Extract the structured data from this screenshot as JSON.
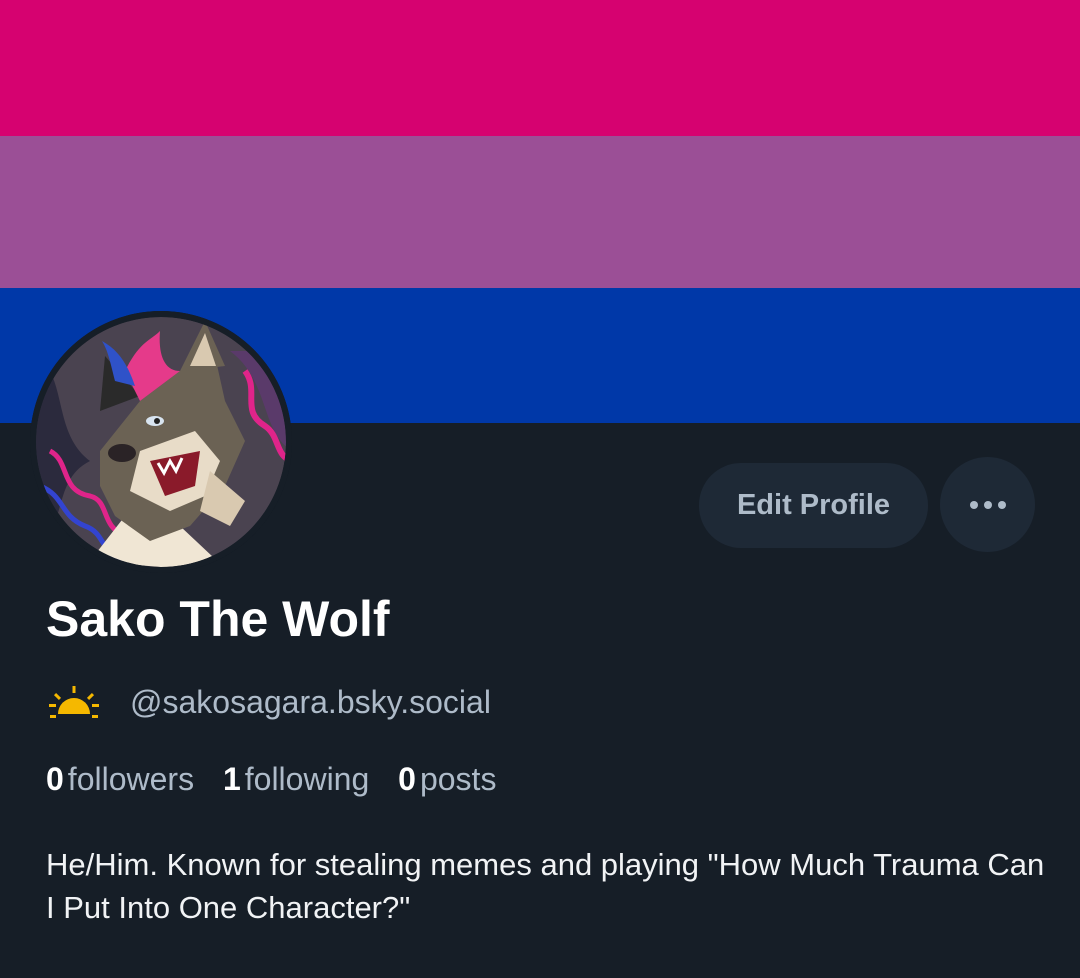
{
  "banner": {
    "colors": [
      "#d60270",
      "#9b4f96",
      "#0038a8"
    ]
  },
  "profile": {
    "avatar_icon": "wolf-avatar-image",
    "display_name": "Sako The Wolf",
    "handle": "@sakosagara.bsky.social",
    "handle_icon": "sunrise-icon",
    "bio": "He/Him. Known for stealing memes and playing \"How Much Trauma Can I Put Into One Character?\""
  },
  "actions": {
    "edit_profile_label": "Edit Profile",
    "more_icon": "more-horizontal-icon"
  },
  "stats": {
    "followers_count": "0",
    "followers_label": "followers",
    "following_count": "1",
    "following_label": "following",
    "posts_count": "0",
    "posts_label": "posts"
  },
  "colors": {
    "background": "#161e27",
    "button_background": "#1e2936",
    "muted_text": "#aebbc9",
    "sunrise_yellow": "#f5b800"
  }
}
